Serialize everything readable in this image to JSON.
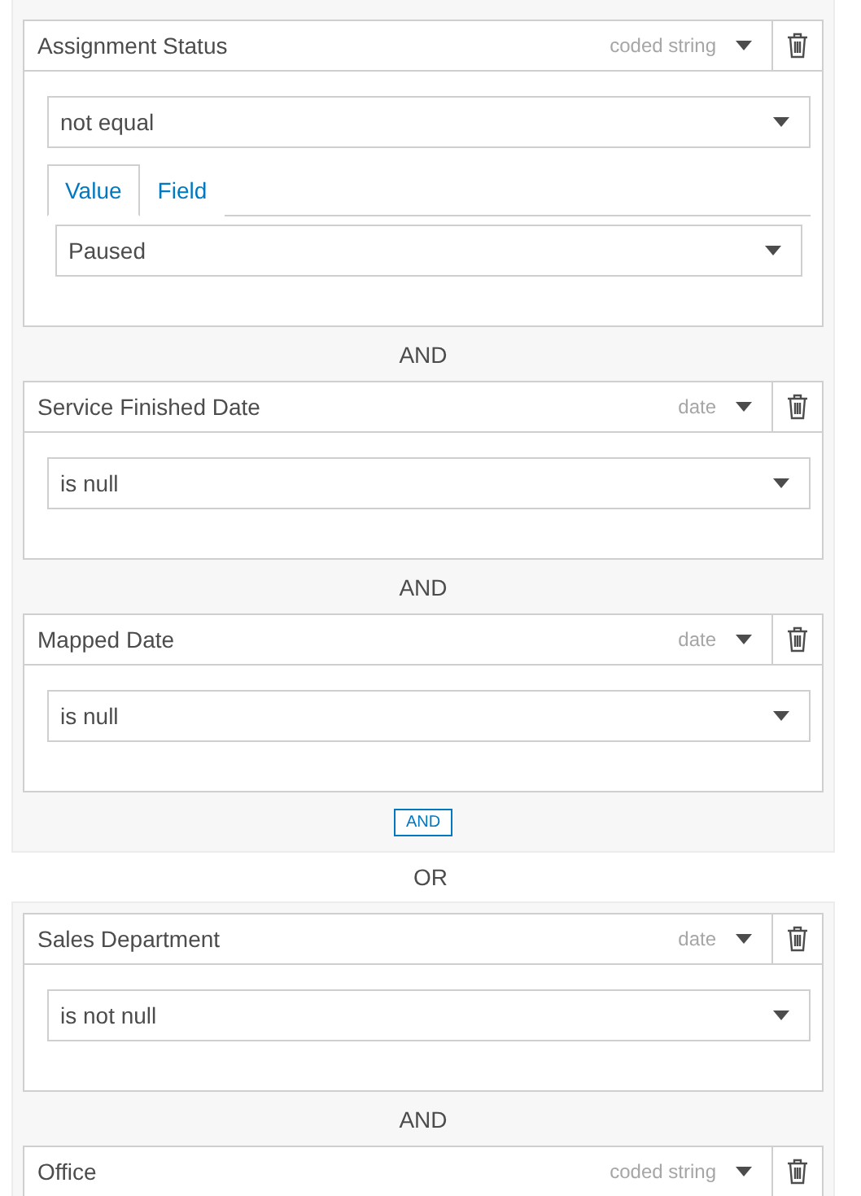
{
  "groups": [
    {
      "conditions": [
        {
          "field": "Assignment Status",
          "type": "coded string",
          "operator": "not equal",
          "tabs": [
            {
              "label": "Value",
              "selected": true
            },
            {
              "label": "Field",
              "selected": false
            }
          ],
          "value": "Paused"
        },
        {
          "connector": "AND",
          "field": "Service Finished Date",
          "type": "date",
          "operator": "is null"
        },
        {
          "connector": "AND",
          "field": "Mapped Date",
          "type": "date",
          "operator": "is null"
        }
      ],
      "add_button": "AND"
    },
    {
      "connector": "OR",
      "conditions": [
        {
          "field": "Sales Department",
          "type": "date",
          "operator": "is not null"
        },
        {
          "connector": "AND",
          "field": "Office",
          "type": "coded string"
        }
      ]
    }
  ]
}
